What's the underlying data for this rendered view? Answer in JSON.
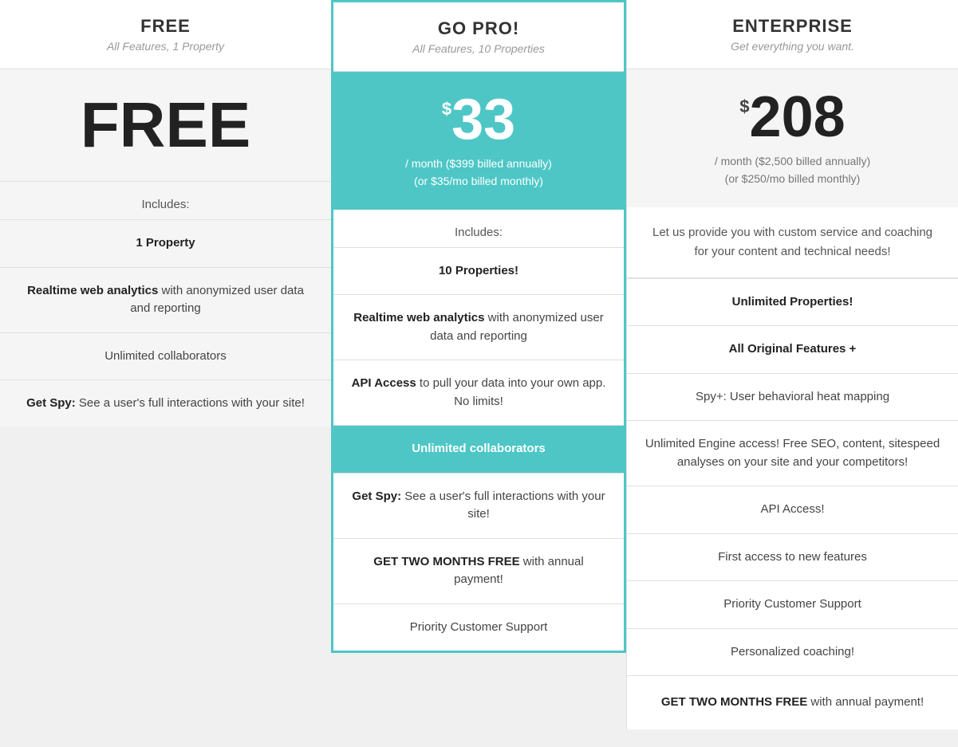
{
  "free": {
    "plan_name": "FREE",
    "plan_subtitle": "All Features, 1 Property",
    "price_big": "FREE",
    "includes_label": "Includes:",
    "features": [
      {
        "text": "1 Property",
        "bold_part": "",
        "rest": "1 Property"
      },
      {
        "bold_part": "Realtime web analytics",
        "rest": " with anonymized user data and reporting"
      },
      {
        "text": "Unlimited collaborators",
        "bold_part": "",
        "rest": "Unlimited collaborators"
      },
      {
        "bold_part": "Get Spy:",
        "rest": " See a user's full interactions with your site!"
      }
    ]
  },
  "pro": {
    "plan_name": "GO PRO!",
    "plan_subtitle": "All Features, 10 Properties",
    "price_currency": "$",
    "price_big": "33",
    "price_period_line1": "/ month ($399 billed annually)",
    "price_period_line2": "(or $35/mo billed monthly)",
    "includes_label": "Includes:",
    "features": [
      {
        "bold_part": "",
        "rest": "10 Properties!",
        "highlight": false
      },
      {
        "bold_part": "Realtime web analytics",
        "rest": " with anonymized user data and reporting",
        "highlight": false
      },
      {
        "bold_part": "API Access",
        "rest": " to pull your data into your own app. No limits!",
        "highlight": false
      },
      {
        "bold_part": "Unlimited collaborators",
        "rest": "",
        "highlight": true
      },
      {
        "bold_part": "Get Spy:",
        "rest": " See a user's full interactions with your site!",
        "highlight": false
      },
      {
        "bold_part": "GET TWO MONTHS FREE",
        "rest": " with annual payment!",
        "highlight": false
      },
      {
        "bold_part": "",
        "rest": "Priority Customer Support",
        "highlight": false
      }
    ]
  },
  "enterprise": {
    "plan_name": "ENTERPRISE",
    "plan_subtitle": "Get everything you want.",
    "price_currency": "$",
    "price_big": "208",
    "price_period_line1": "/ month ($2,500 billed annually)",
    "price_period_line2": "(or $250/mo billed monthly)",
    "custom_desc": "Let us provide you with custom service and coaching for your content and technical needs!",
    "features": [
      {
        "bold_part": "",
        "rest": "Unlimited Properties!"
      },
      {
        "bold_part": "",
        "rest": "All Original Features +"
      },
      {
        "bold_part": "",
        "rest": "Spy+: User behavioral heat mapping"
      },
      {
        "bold_part": "",
        "rest": "Unlimited Engine access! Free SEO, content, sitespeed analyses on your site and your competitors!"
      },
      {
        "bold_part": "",
        "rest": "API Access!"
      },
      {
        "bold_part": "",
        "rest": "First access to new features"
      },
      {
        "bold_part": "",
        "rest": "Priority Customer Support"
      },
      {
        "bold_part": "",
        "rest": "Personalized coaching!"
      }
    ],
    "cta_bold": "GET TWO MONTHS FREE",
    "cta_rest": " with annual payment!"
  }
}
